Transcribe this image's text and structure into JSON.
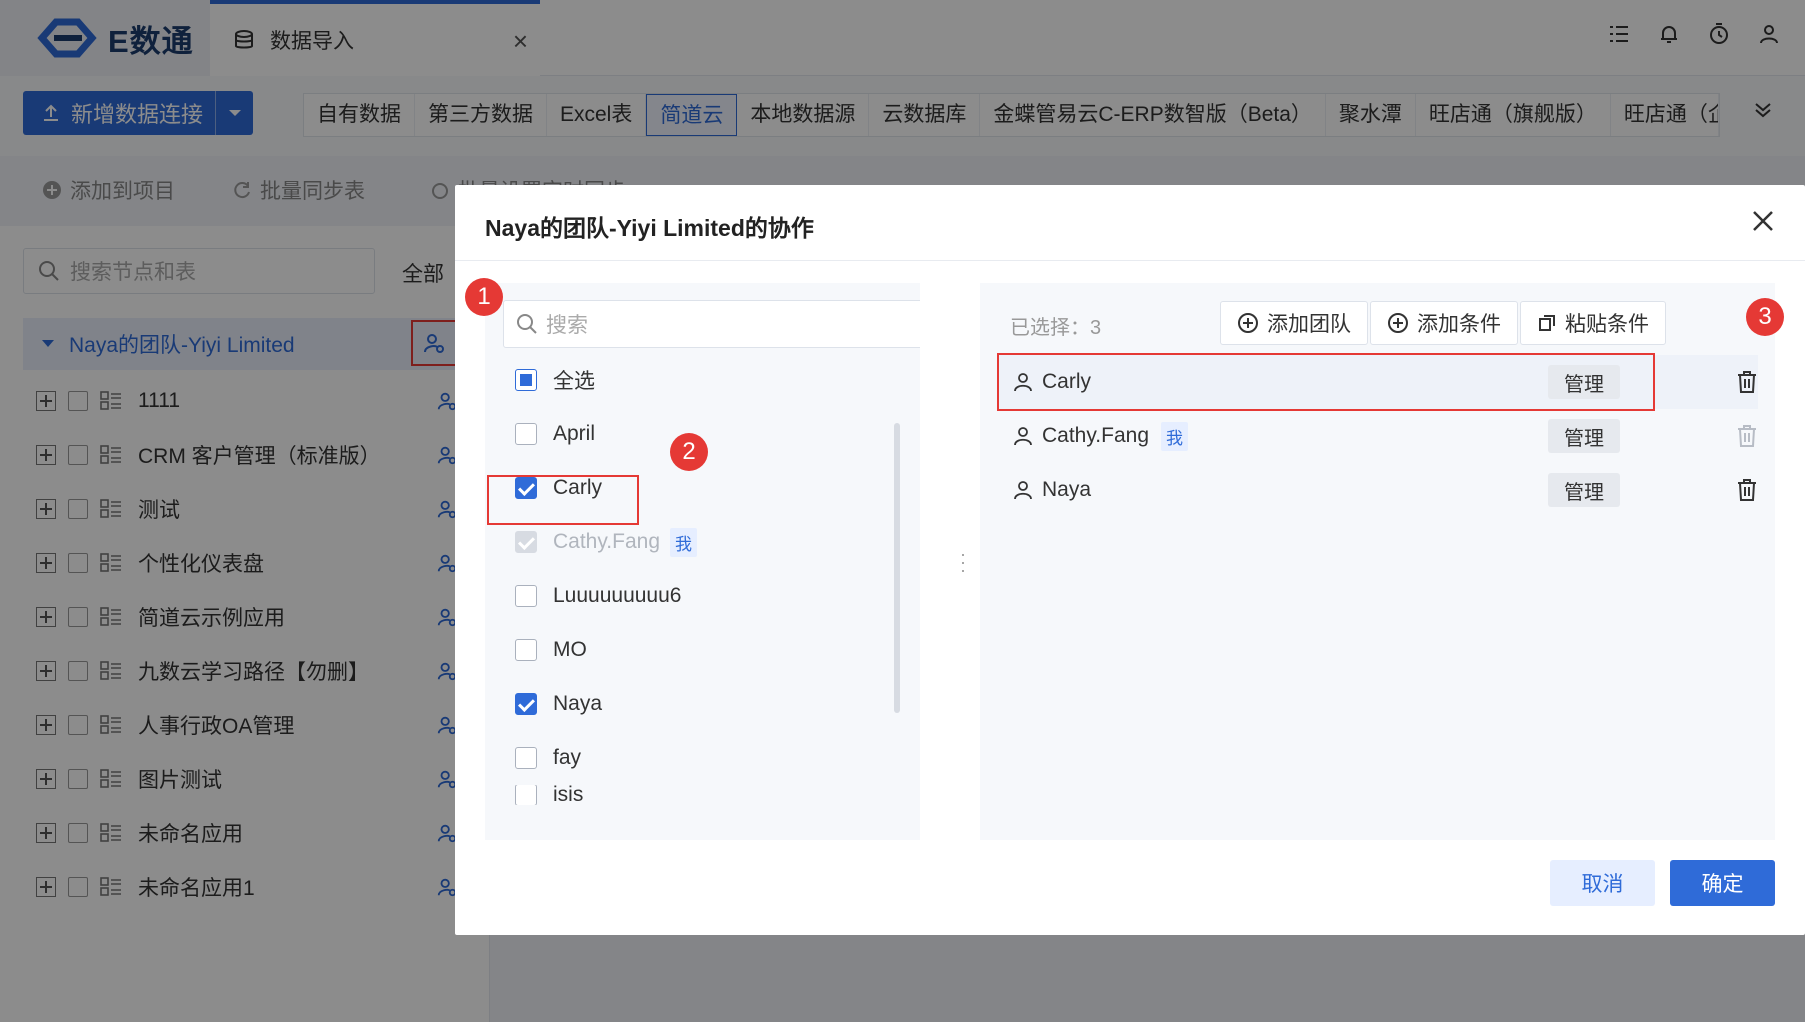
{
  "app": {
    "logo_text": "E数通",
    "tab_label": "数据导入",
    "tab_close": "×"
  },
  "toolbar": {
    "new_connection": "新增数据连接",
    "source_tabs": [
      "自有数据",
      "第三方数据",
      "Excel表",
      "简道云",
      "本地数据源",
      "云数据库",
      "金蝶管易云C-ERP数智版（Beta）",
      "聚水潭",
      "旺店通（旗舰版）",
      "旺店通（企"
    ],
    "active_source_tab": "简道云"
  },
  "actions": {
    "add_to_project": "添加到项目",
    "batch_sync": "批量同步表",
    "batch_schedule": "批量设置定时同步"
  },
  "left_panel": {
    "search_placeholder": "搜索节点和表",
    "filter_label": "全部",
    "root_node": "Naya的团队-Yiyi Limited",
    "items": [
      "1111",
      "CRM 客户管理（标准版）",
      "测试",
      "个性化仪表盘",
      "简道云示例应用",
      "九数云学习路径【勿删】",
      "人事行政OA管理",
      "图片测试",
      "未命名应用",
      "未命名应用1"
    ]
  },
  "modal": {
    "title": "Naya的团队-Yiyi Limited的协作",
    "search_placeholder": "搜索",
    "select_all": "全选",
    "members": [
      {
        "name": "April",
        "state": "unchecked"
      },
      {
        "name": "Carly",
        "state": "checked"
      },
      {
        "name": "Cathy.Fang",
        "state": "disabled",
        "tag": "我"
      },
      {
        "name": "Luuuuuuuuu6",
        "state": "unchecked"
      },
      {
        "name": "MO",
        "state": "unchecked"
      },
      {
        "name": "Naya",
        "state": "checked"
      },
      {
        "name": "fay",
        "state": "unchecked"
      },
      {
        "name": "isis",
        "state": "unchecked"
      }
    ],
    "selected_label": "已选择：3",
    "add_team": "添加团队",
    "add_condition": "添加条件",
    "paste_condition": "粘贴条件",
    "selected": [
      {
        "name": "Carly",
        "role": "管理",
        "tag": ""
      },
      {
        "name": "Cathy.Fang",
        "role": "管理",
        "tag": "我"
      },
      {
        "name": "Naya",
        "role": "管理",
        "tag": ""
      }
    ],
    "cancel": "取消",
    "confirm": "确定"
  },
  "annotations": [
    "1",
    "2",
    "3"
  ],
  "colors": {
    "accent": "#2f6bd8",
    "highlight": "#e53935"
  }
}
